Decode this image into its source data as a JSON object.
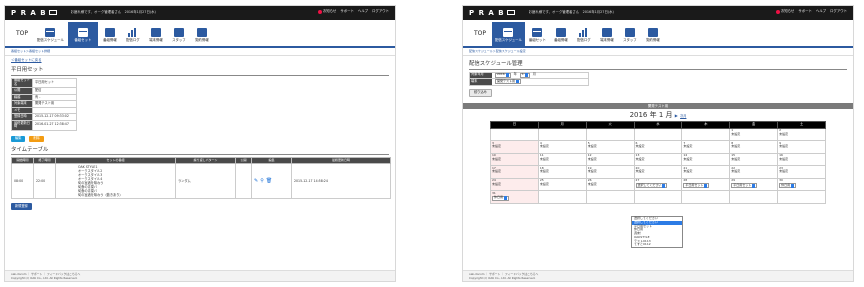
{
  "left": {
    "logo": "P  R A B",
    "welcome": "お疲れ様です、オーク管理者さん　2016年1月27日(水)",
    "toplinks": [
      "お知らせ",
      "サポート",
      "ヘルプ",
      "ログアウト"
    ],
    "nav": [
      "TOP",
      "配信スケジュール",
      "番組セット",
      "番組情報",
      "配信ログ",
      "端末情報",
      "スタッフ",
      "契約情報"
    ],
    "breadcrumb": "番組セット＞番組セット詳細",
    "back_link": "＜番組セットに戻る",
    "section_title": "平日用セット",
    "info_rows": [
      {
        "label": "番組セット名",
        "value": "平日用セット"
      },
      {
        "label": "公開",
        "value": "配信"
      },
      {
        "label": "繰越",
        "value": "有 -"
      },
      {
        "label": "対象端末",
        "value": "開発テスト用"
      },
      {
        "label": "メモ",
        "value": ""
      },
      {
        "label": "登録日時",
        "value": "2015-12-17 09:33:02"
      },
      {
        "label": "最終更新日時",
        "value": "2016-01-27 12:38:47"
      }
    ],
    "edit_button": "編集",
    "delete_button": "削除",
    "timetable_title": "タイムテーブル",
    "timetable_headers": [
      "開始時間",
      "終了時間",
      "セットの番組",
      "繰り返しパターン",
      "公開",
      "編集",
      "最終更新日時"
    ],
    "timetable_row": {
      "start": "08:00",
      "end": "22:00",
      "programs": [
        "OAK STYLE1",
        "オークスタイル2",
        "オークスタイル3",
        "オークスタイル4",
        "旬の旨酒を味わう",
        "旬食の青菜バ",
        "旬食の青菜バ",
        "旬の旨酒を味わう（動きあり）"
      ],
      "pattern": "ランダム",
      "updated": "2015-12-17 14:58:24"
    },
    "new_button": "新規登録",
    "footer_links": "oak-docom ｜ サポート ｜ フィードバックはこちらへ",
    "copyright": "Copyright (c) OAK Co., Ltd. All Rights Reserved."
  },
  "right": {
    "logo": "P  R A B",
    "welcome": "お疲れ様です、オーク管理者さん　2016年1月27日(水)",
    "toplinks": [
      "お知らせ",
      "サポート",
      "ヘルプ",
      "ログアウト"
    ],
    "nav": [
      "TOP",
      "配信スケジュール",
      "番組セット",
      "番組情報",
      "配信ログ",
      "端末情報",
      "スタッフ",
      "契約情報"
    ],
    "breadcrumb": "配信スケジュール＞配信スケジュール設定",
    "section_title": "配信スケジュール管理",
    "form": {
      "month_label": "対象年月",
      "year": "2016",
      "year_unit": "年",
      "month": "1",
      "month_unit": "月",
      "device_label": "端末",
      "device": "開発テスト用"
    },
    "filter_button": "絞り込み",
    "band_text": "開発テスト用",
    "cal_title": "2016 年 1 月",
    "cal_next": "次月",
    "weekdays": [
      "日",
      "月",
      "火",
      "水",
      "木",
      "金",
      "土"
    ],
    "weeks": [
      [
        "",
        "",
        "",
        "",
        "",
        "1\n未設定",
        "2\n未設定"
      ],
      [
        "3\n未設定",
        "4\n未設定",
        "5\n未設定",
        "6\n未設定",
        "7\n未設定",
        "8\n未設定",
        "9\n未設定"
      ],
      [
        "10\n未設定",
        "11\n未設定",
        "12\n未設定",
        "13\n未設定",
        "14\n未設定",
        "15\n未設定",
        "16\n未設定"
      ],
      [
        "17\n未設定",
        "18\n未設定",
        "19\n未設定",
        "20\n未設定",
        "21\n未設定",
        "22\n未設定",
        "23\n未設定"
      ],
      [
        "24\n未設定",
        "25\n未設定",
        "26\n未設定",
        "27",
        "28",
        "29",
        "30"
      ],
      [
        "31",
        "",
        "",
        "",
        "",
        "",
        ""
      ]
    ],
    "cell_selects": {
      "w27": "選択してください",
      "w28": "平日用セット",
      "w29": "平日用セット",
      "w30": "休日用",
      "w31": "休日用"
    },
    "dropdown_options": [
      "選択してください",
      "選択してください",
      "平日用セット",
      "休日用",
      "週末！",
      "OAKSTYLE",
      "テスト0113",
      "てすと0112"
    ],
    "footer_links": "oak-docom ｜ サポート ｜ フィードバックはこちらへ",
    "copyright": "Copyright (c) OAK Co., Ltd. All Rights Reserved."
  }
}
